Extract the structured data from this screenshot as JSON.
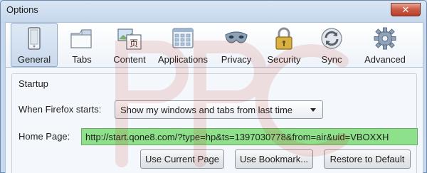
{
  "window": {
    "title": "Options",
    "close_glyph": "✕"
  },
  "toolbar": {
    "tabs": [
      {
        "label": "General",
        "icon": "general-icon"
      },
      {
        "label": "Tabs",
        "icon": "tabs-icon"
      },
      {
        "label": "Content",
        "icon": "content-icon"
      },
      {
        "label": "Applications",
        "icon": "applications-icon"
      },
      {
        "label": "Privacy",
        "icon": "privacy-mask-icon"
      },
      {
        "label": "Security",
        "icon": "padlock-icon"
      },
      {
        "label": "Sync",
        "icon": "sync-icon"
      },
      {
        "label": "Advanced",
        "icon": "gear-icon"
      }
    ],
    "active_tab": "General"
  },
  "startup": {
    "group_title": "Startup",
    "when_starts_label": "When Firefox starts:",
    "when_starts_value": "Show my windows and tabs from last time",
    "home_page_label": "Home Page:",
    "home_page_value": "http://start.qone8.com/?type=hp&ts=1397030778&from=air&uid=VBOXXH",
    "buttons": {
      "use_current": "Use Current Page",
      "use_bookmark": "Use Bookmark...",
      "restore_default": "Restore to Default"
    }
  },
  "colors": {
    "homepage_highlight": "#8fe08a",
    "close_button": "#c95a41",
    "active_tab_bg": "#c9d9ec"
  }
}
